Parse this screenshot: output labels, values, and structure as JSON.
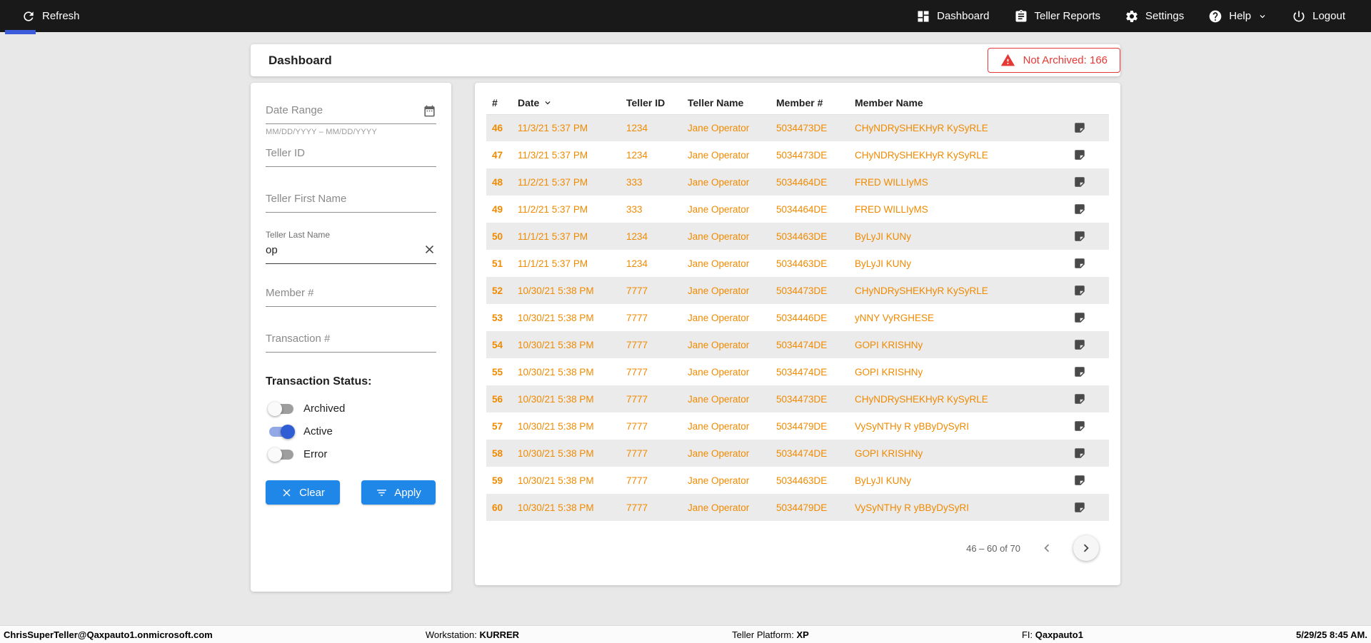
{
  "topbar": {
    "refresh": {
      "label": "Refresh",
      "icon": "refresh-icon"
    },
    "nav": [
      {
        "label": "Dashboard",
        "icon": "dashboard-icon"
      },
      {
        "label": "Teller Reports",
        "icon": "teller-reports-icon"
      },
      {
        "label": "Settings",
        "icon": "settings-gear-icon"
      },
      {
        "label": "Help",
        "icon": "help-icon",
        "dropdown": true,
        "dropdown_icon": "chevron-down-icon"
      },
      {
        "label": "Logout",
        "icon": "logout-power-icon"
      }
    ]
  },
  "page_header": {
    "title": "Dashboard",
    "not_archived": {
      "label": "Not Archived: 166",
      "count": 166,
      "icon": "warning-icon"
    }
  },
  "filters": {
    "date_range": {
      "placeholder": "Date Range",
      "hint": "MM/DD/YYYY – MM/DD/YYYY",
      "value": "",
      "icon": "calendar-icon"
    },
    "teller_id": {
      "placeholder": "Teller ID",
      "value": ""
    },
    "teller_first_name": {
      "placeholder": "Teller First Name",
      "value": ""
    },
    "teller_last_name": {
      "label": "Teller Last Name",
      "value": "op",
      "clear_icon": "close-x-icon"
    },
    "member_number": {
      "placeholder": "Member #",
      "value": ""
    },
    "transaction_number": {
      "placeholder": "Transaction #",
      "value": ""
    },
    "status_heading": "Transaction Status:",
    "toggles": [
      {
        "label": "Archived",
        "on": false
      },
      {
        "label": "Active",
        "on": true
      },
      {
        "label": "Error",
        "on": false
      }
    ],
    "buttons": [
      {
        "label": "Clear",
        "icon": "close-x-icon"
      },
      {
        "label": "Apply",
        "icon": "filter-icon"
      }
    ]
  },
  "table": {
    "columns": [
      "#",
      "Date",
      "Teller ID",
      "Teller Name",
      "Member #",
      "Member Name"
    ],
    "sorted_column": "Date",
    "sort_icon": "sort-desc-icon",
    "row_action_icon": "note-icon",
    "rows": [
      [
        "46",
        "11/3/21 5:37 PM",
        "1234",
        "Jane Operator",
        "5034473DE",
        "CHyNDRySHEKHyR KySyRLE"
      ],
      [
        "47",
        "11/3/21 5:37 PM",
        "1234",
        "Jane Operator",
        "5034473DE",
        "CHyNDRySHEKHyR KySyRLE"
      ],
      [
        "48",
        "11/2/21 5:37 PM",
        "333",
        "Jane Operator",
        "5034464DE",
        "FRED WILLIyMS"
      ],
      [
        "49",
        "11/2/21 5:37 PM",
        "333",
        "Jane Operator",
        "5034464DE",
        "FRED WILLIyMS"
      ],
      [
        "50",
        "11/1/21 5:37 PM",
        "1234",
        "Jane Operator",
        "5034463DE",
        "ByLyJI KUNy"
      ],
      [
        "51",
        "11/1/21 5:37 PM",
        "1234",
        "Jane Operator",
        "5034463DE",
        "ByLyJI KUNy"
      ],
      [
        "52",
        "10/30/21 5:38 PM",
        "7777",
        "Jane Operator",
        "5034473DE",
        "CHyNDRySHEKHyR KySyRLE"
      ],
      [
        "53",
        "10/30/21 5:38 PM",
        "7777",
        "Jane Operator",
        "5034446DE",
        "yNNY VyRGHESE"
      ],
      [
        "54",
        "10/30/21 5:38 PM",
        "7777",
        "Jane Operator",
        "5034474DE",
        "GOPI KRISHNy"
      ],
      [
        "55",
        "10/30/21 5:38 PM",
        "7777",
        "Jane Operator",
        "5034474DE",
        "GOPI KRISHNy"
      ],
      [
        "56",
        "10/30/21 5:38 PM",
        "7777",
        "Jane Operator",
        "5034473DE",
        "CHyNDRySHEKHyR KySyRLE"
      ],
      [
        "57",
        "10/30/21 5:38 PM",
        "7777",
        "Jane Operator",
        "5034479DE",
        "VySyNTHy R yBByDySyRI"
      ],
      [
        "58",
        "10/30/21 5:38 PM",
        "7777",
        "Jane Operator",
        "5034474DE",
        "GOPI KRISHNy"
      ],
      [
        "59",
        "10/30/21 5:38 PM",
        "7777",
        "Jane Operator",
        "5034463DE",
        "ByLyJI KUNy"
      ],
      [
        "60",
        "10/30/21 5:38 PM",
        "7777",
        "Jane Operator",
        "5034479DE",
        "VySyNTHy R yBByDySyRI"
      ]
    ],
    "paginator": {
      "range_label": "46 – 60 of 70",
      "prev_icon": "chevron-left-icon",
      "next_icon": "chevron-right-icon"
    }
  },
  "statusbar": {
    "user": "ChrisSuperTeller@Qaxpauto1.onmicrosoft.com",
    "workstation": {
      "label": "Workstation:",
      "value": "KURRER"
    },
    "teller_platform": {
      "label": "Teller Platform:",
      "value": "XP"
    },
    "fi": {
      "label": "FI:",
      "value": "Qaxpauto1"
    },
    "timestamp": "5/29/25 8:45 AM."
  },
  "colors": {
    "topbar_bg": "#191919",
    "accent_blue": "#1f87e8",
    "toggle_on_blue": "#2f5ed4",
    "tab_indicator_blue": "#3b5bdb",
    "row_text_orange": "#f08a00",
    "alert_red": "#e53935",
    "zebra_gray": "#ebebeb"
  }
}
